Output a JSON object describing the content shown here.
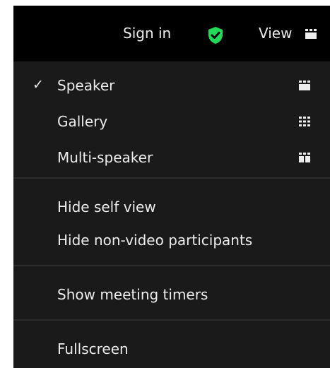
{
  "topbar": {
    "sign_in_label": "Sign in",
    "view_label": "View",
    "security_icon": "shield-check-icon",
    "security_color": "#23d959"
  },
  "menu": {
    "layout_items": [
      {
        "label": "Speaker",
        "checked": true,
        "icon": "speaker-view-icon"
      },
      {
        "label": "Gallery",
        "checked": false,
        "icon": "gallery-view-icon"
      },
      {
        "label": "Multi-speaker",
        "checked": false,
        "icon": "multi-speaker-view-icon"
      }
    ],
    "check_mark": "✓",
    "hide_self_view": "Hide self view",
    "hide_non_video": "Hide non-video participants",
    "show_timers": "Show meeting timers",
    "fullscreen": "Fullscreen"
  },
  "colors": {
    "background": "#000000",
    "menu_background": "#1a1a1a",
    "text": "#ececec",
    "divider": "#2c2c2c"
  }
}
